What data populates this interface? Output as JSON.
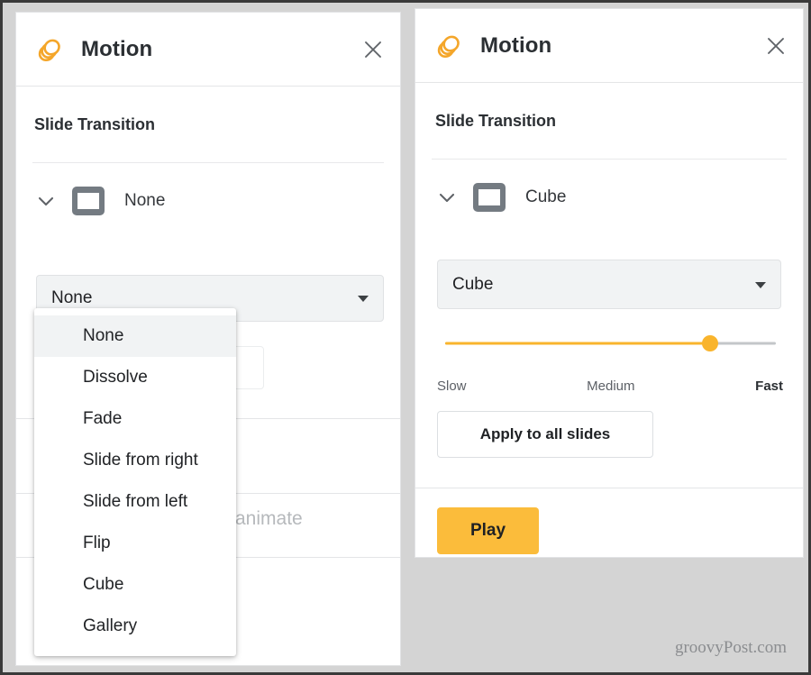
{
  "app": {
    "title": "Motion",
    "logo_icon": "stacked-circles-icon",
    "close_icon": "close-icon",
    "accent_color": "#f9b42c",
    "primary_button_color": "#fbbc3b"
  },
  "left_panel": {
    "title": "Motion",
    "section_label": "Slide Transition",
    "transition_row": {
      "chevron_icon": "chevron-down-icon",
      "thumb_icon": "slide-thumbnail-icon",
      "name": "None"
    },
    "select": {
      "value": "None",
      "caret_icon": "caret-down-icon"
    },
    "dropdown": {
      "open": true,
      "selected": "None",
      "options": [
        "None",
        "Dissolve",
        "Fade",
        "Slide from right",
        "Slide from left",
        "Flip",
        "Cube",
        "Gallery"
      ]
    },
    "obscured_text": "animate"
  },
  "right_panel": {
    "title": "Motion",
    "section_label": "Slide Transition",
    "transition_row": {
      "chevron_icon": "chevron-down-icon",
      "thumb_icon": "slide-thumbnail-icon",
      "name": "Cube"
    },
    "select": {
      "value": "Cube",
      "caret_icon": "caret-down-icon"
    },
    "speed_slider": {
      "value_percent": 80,
      "labels": {
        "min": "Slow",
        "mid": "Medium",
        "max": "Fast"
      }
    },
    "apply_button": "Apply to all slides",
    "play_button": "Play"
  },
  "watermark": "groovyPost.com"
}
